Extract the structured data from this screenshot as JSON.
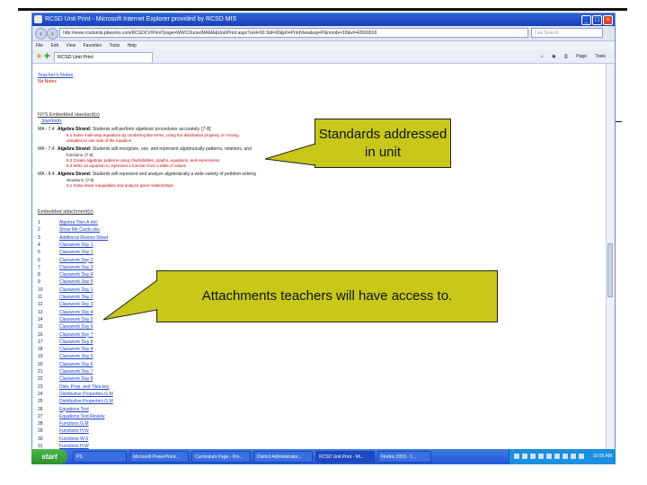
{
  "window": {
    "title": "RCSD Unit Print - Microsoft Internet Explorer provided by RCSD MIS",
    "address": "http://www.rcsdunits.pbworks.com/RCSDCV/Print?page=WWCOurse/MAMA&Unit/Print.aspx?unit=90 Std=60&ph=PrintView&wp=P&rmode=18&vt=42000018",
    "search_placeholder": "Live Search",
    "menu": [
      "File",
      "Edit",
      "View",
      "Favorites",
      "Tools",
      "Help"
    ],
    "tab_label": "RCSD Unit Print",
    "tools_labels": [
      "Page",
      "Tools"
    ]
  },
  "page": {
    "teachers_notes_label": "Teacher's Notes",
    "teachers_notes_value": "No Notes",
    "standards_label": "NYS Embedded standard(s)",
    "standards_sub": "Standards",
    "standards": [
      {
        "code": "MA - 7.4",
        "strand": "Algebra Strand:",
        "text": "Students will perform algebraic procedures accurately. [7-8]",
        "details": [
          "5.1 Solve multi-step equations by combining like terms, using the distributive property, or moving",
          "variables to one side of the equation"
        ]
      },
      {
        "code": "MA - 7.4",
        "strand": "Algebra Strand:",
        "text": "Students will recognize, use, and represent algebraically patterns, relations, and",
        "details": [
          "functions. [7-8]",
          "8.2 Create algebraic patterns using charts/tables, graphs, equations, and expressions",
          "8.3 Write an equation to represent a function from a table of values"
        ]
      },
      {
        "code": "MA - 8.4",
        "strand": "Algebra Strand:",
        "text": "Students will represent and analyze algebraically a wide variety of problem solving",
        "details": [
          "situations. [7-8]",
          "8.1 Solve linear inequalities and analyze given relationships"
        ]
      }
    ],
    "attachments_label": "Embedded attachment(s)",
    "attachments": [
      {
        "n": "1",
        "name": "Algebra Tiles A.doc"
      },
      {
        "n": "2",
        "name": "Show Me Cards.doc"
      },
      {
        "n": "3",
        "name": "Additional Review Sheet"
      },
      {
        "n": "4",
        "name": "Classwork Day 1"
      },
      {
        "n": "5",
        "name": "Classwork Day 1"
      },
      {
        "n": "6",
        "name": "Classwork Day 2"
      },
      {
        "n": "7",
        "name": "Classwork Day 3"
      },
      {
        "n": "8",
        "name": "Classwork Day 4"
      },
      {
        "n": "9",
        "name": "Classwork Day 5"
      },
      {
        "n": "10",
        "name": "Classwork Day 1"
      },
      {
        "n": "11",
        "name": "Classwork Day 2"
      },
      {
        "n": "12",
        "name": "Classwork Day 3"
      },
      {
        "n": "13",
        "name": "Classwork Day 4"
      },
      {
        "n": "14",
        "name": "Classwork Day 5"
      },
      {
        "n": "15",
        "name": "Classwork Day 6"
      },
      {
        "n": "16",
        "name": "Classwork Day 7"
      },
      {
        "n": "17",
        "name": "Classwork Day 8"
      },
      {
        "n": "18",
        "name": "Classwork Day 4"
      },
      {
        "n": "19",
        "name": "Classwork Day 5"
      },
      {
        "n": "20",
        "name": "Classwork Day 6"
      },
      {
        "n": "21",
        "name": "Classwork Day 7"
      },
      {
        "n": "22",
        "name": "Classwork Day 8"
      },
      {
        "n": "23",
        "name": "Distr. Prop. and Tiles.key"
      },
      {
        "n": "24",
        "name": "Distributive Properties.G.M"
      },
      {
        "n": "25",
        "name": "Distributive Properties.G.M"
      },
      {
        "n": "26",
        "name": "Equations Test"
      },
      {
        "n": "27",
        "name": "Equations Test Review"
      },
      {
        "n": "28",
        "name": "Functions.G.M"
      },
      {
        "n": "29",
        "name": "Functions H.W"
      },
      {
        "n": "30",
        "name": "Functions W.S"
      },
      {
        "n": "31",
        "name": "Functions H.W"
      }
    ]
  },
  "callouts": {
    "standards": "Standards addressed in unit",
    "attachments": "Attachments teachers will have access to."
  },
  "taskbar": {
    "start": "start",
    "tasks": [
      "PS",
      "Microsoft PowerPoint...",
      "Curriculum Page - Pro...",
      "District Administrator...",
      "RCSD Unit Print - Mi...",
      "Firefox 2003 - 1..."
    ],
    "clock": "10:05 AM"
  },
  "colors": {
    "callout_fill": "#c8c81a",
    "link": "#1a3fcc",
    "detail_text": "#cc0000"
  }
}
